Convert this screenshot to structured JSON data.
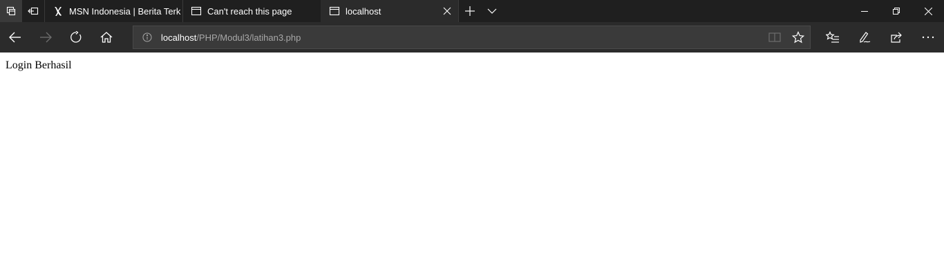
{
  "browser": {
    "colors": {
      "titlebar": "#1f1f1f",
      "toolbar": "#2b2b2b",
      "address_field": "#3a3a3a",
      "icon": "#ffffff",
      "icon_disabled": "#6d6d6d"
    }
  },
  "tabs": [
    {
      "title": "MSN Indonesia | Berita Terk",
      "favicon": "msn-butterfly-icon",
      "active": false
    },
    {
      "title": "Can't reach this page",
      "favicon": "page-icon",
      "active": false
    },
    {
      "title": "localhost",
      "favicon": "page-icon",
      "active": true
    }
  ],
  "address": {
    "host": "localhost",
    "path": "/PHP/Modul3/latihan3.php"
  },
  "page": {
    "message": "Login Berhasil"
  }
}
